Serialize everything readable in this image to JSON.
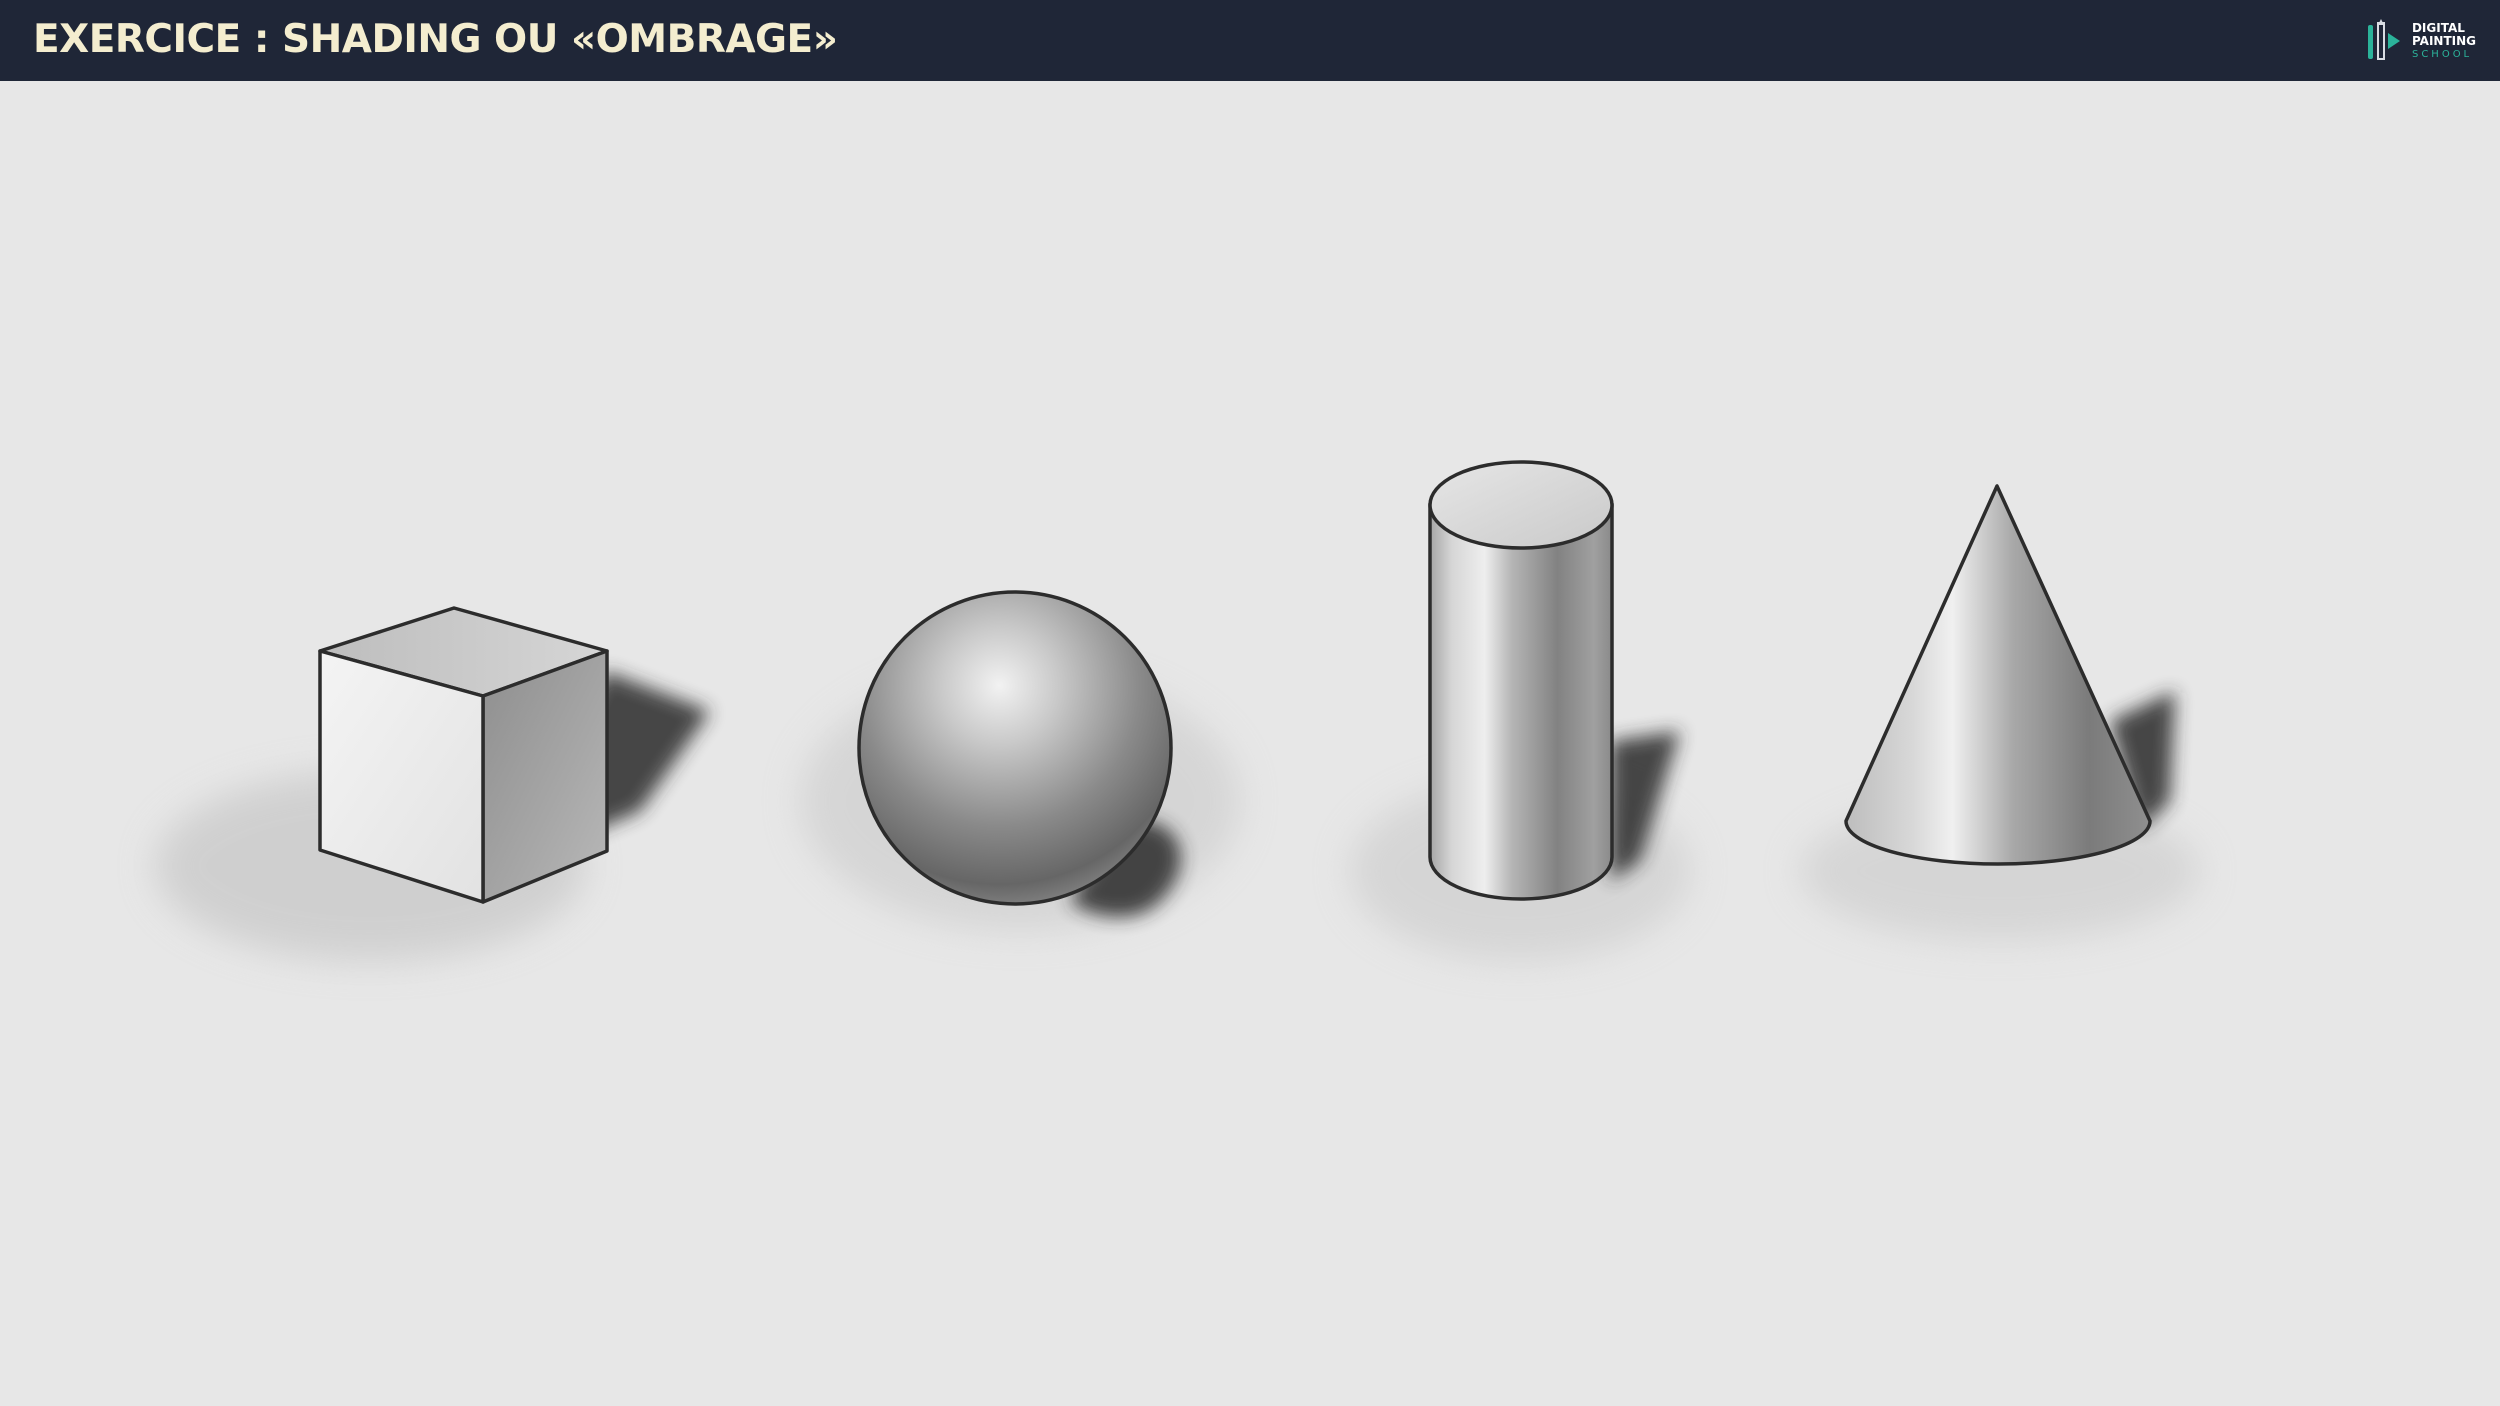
{
  "header": {
    "title": "EXERCICE : SHADING OU «OMBRAGE»",
    "background_color": "#1f2637",
    "title_color": "#f4edcf"
  },
  "logo": {
    "line1": "DIGITAL",
    "line2": "PAINTING",
    "line3": "SCHOOL",
    "accent_color": "#2bb39a"
  },
  "canvas": {
    "background_color": "#e7e7e7",
    "shapes": [
      "cube",
      "sphere",
      "cylinder",
      "cone"
    ]
  }
}
